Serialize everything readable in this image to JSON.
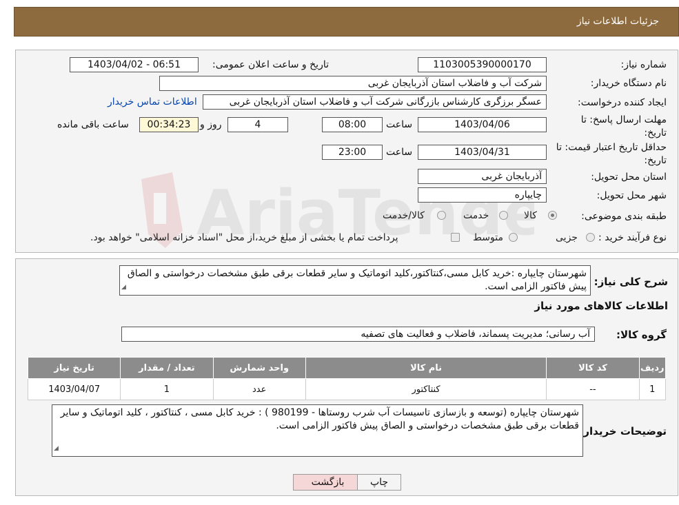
{
  "header": {
    "title": "جزئیات اطلاعات نیاز"
  },
  "form": {
    "need_number_label": "شماره نیاز:",
    "need_number": "1103005390000170",
    "announce_label": "تاریخ و ساعت اعلان عمومی:",
    "announce_value": "1403/04/02 - 06:51",
    "buyer_org_label": "نام دستگاه خریدار:",
    "buyer_org": "شرکت آب و فاضلاب استان آذربایجان غربی",
    "creator_label": "ایجاد کننده درخواست:",
    "creator": "عسگر  برزگری کارشناس بازرگانی شرکت آب و فاضلاب استان آذربایجان غربی",
    "contact_link": "اطلاعات تماس خریدار",
    "deadline_label": "مهلت ارسال پاسخ: تا تاریخ:",
    "deadline_date": "1403/04/06",
    "time_word": "ساعت",
    "deadline_time": "08:00",
    "days_value": "4",
    "days_word": "روز و",
    "remaining_time": "00:34:23",
    "remaining_word": "ساعت باقی مانده",
    "validity_label": "حداقل تاریخ اعتبار قیمت: تا تاریخ:",
    "validity_date": "1403/04/31",
    "validity_time": "23:00",
    "province_label": "استان محل تحویل:",
    "province": "آذربایجان غربی",
    "city_label": "شهر محل تحویل:",
    "city": "چایپاره",
    "category_label": "طبقه بندی موضوعی:",
    "category_options": [
      "کالا",
      "خدمت",
      "کالا/خدمت"
    ],
    "category_selected": "کالا",
    "process_label": "نوع فرآیند خرید :",
    "process_options": [
      "جزیی",
      "متوسط"
    ],
    "process_note": "پرداخت تمام یا بخشی از مبلغ خرید،از محل \"اسناد خزانه اسلامی\" خواهد بود."
  },
  "summary": {
    "label": "شرح کلی نیاز:",
    "text": "شهرستان چایپاره :خرید کابل مسی،کنتاکتور،کلید اتوماتیک و سایر قطعات برقی طبق مشخصات درخواستی و الصاق پیش فاکتور الزامی است.",
    "goods_info_title": "اطلاعات کالاهای مورد نیاز",
    "group_label": "گروه کالا:",
    "group_value": "آب رسانی؛ مدیریت پسماند، فاضلاب و فعالیت های تصفیه"
  },
  "table": {
    "headers": [
      "ردیف",
      "کد کالا",
      "نام کالا",
      "واحد شمارش",
      "تعداد / مقدار",
      "تاریخ نیاز"
    ],
    "rows": [
      [
        "1",
        "--",
        "کنتاکتور",
        "عدد",
        "1",
        "1403/04/07"
      ]
    ]
  },
  "buyer_notes": {
    "label": "توضیحات خریدار:",
    "text": "شهرستان چایپاره (توسعه و بازسازی تاسیسات آب شرب روستاها - 980199 ) : خرید کابل مسی ،  کنتاکتور ، کلید اتوماتیک و سایر قطعات  برقی  طبق مشخصات درخواستی و الصاق پیش فاکتور الزامی است."
  },
  "buttons": {
    "print": "چاپ",
    "back": "بازگشت"
  },
  "watermark": {
    "text": "AriaTender.neT"
  },
  "colors": {
    "header_bg": "#8e6b3e",
    "table_header_bg": "#8c8c8c",
    "back_button_bg": "#f6d7d7",
    "link": "#0645ad"
  }
}
